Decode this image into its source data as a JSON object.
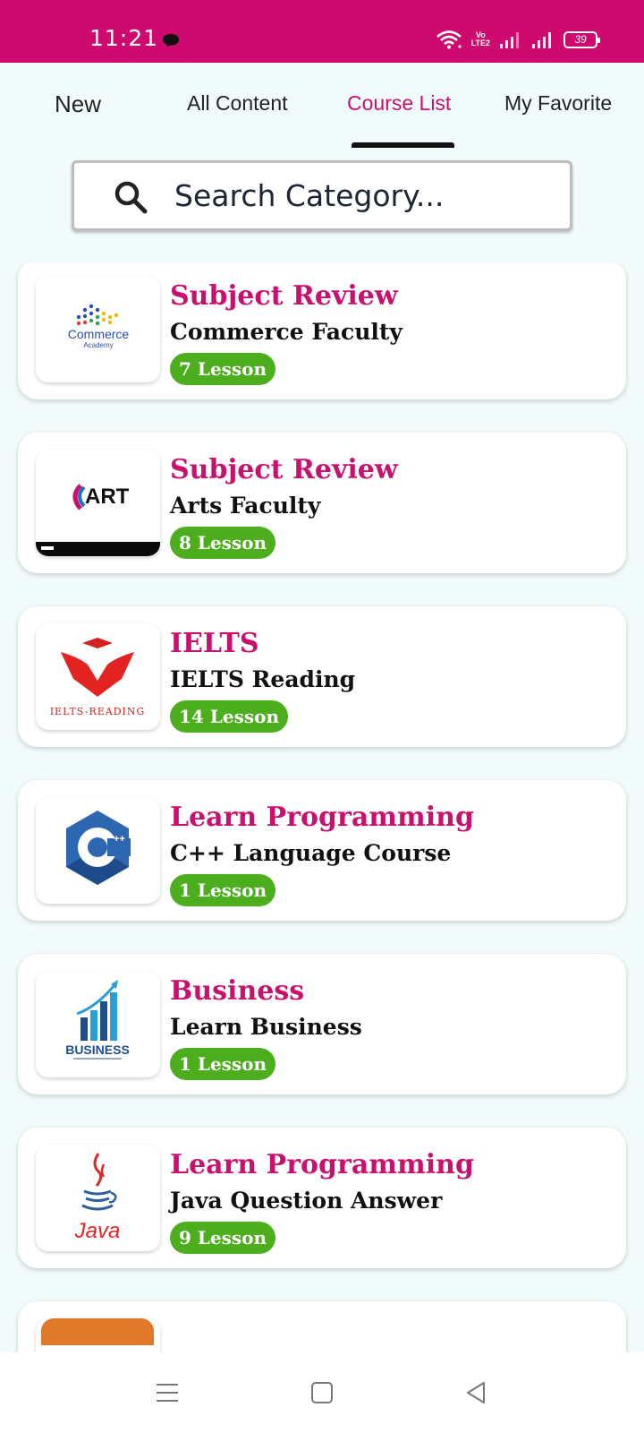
{
  "status_bar": {
    "time": "11:21",
    "battery": "39",
    "network_label": "Vo LTE2",
    "bg_color": "#cf0a6e"
  },
  "tabs": [
    {
      "label": "New",
      "active": false
    },
    {
      "label": "All Content",
      "active": false
    },
    {
      "label": "Course List",
      "active": true
    },
    {
      "label": "My Favorite",
      "active": false
    }
  ],
  "search": {
    "placeholder": "Search Category...",
    "icon": "search-icon"
  },
  "courses": [
    {
      "title": "Subject Review",
      "subtitle": "Commerce Faculty",
      "lessons": "7 Lesson",
      "thumb_icon": "commerce-academy-logo",
      "thumb_text": "Commerce",
      "thumb_subtext": "Academy"
    },
    {
      "title": "Subject Review",
      "subtitle": "Arts Faculty",
      "lessons": "8 Lesson",
      "thumb_icon": "art-logo",
      "thumb_text": "ART"
    },
    {
      "title": "IELTS",
      "subtitle": "IELTS Reading",
      "lessons": "14 Lesson",
      "thumb_icon": "ielts-reading-logo",
      "thumb_text": "IELTS-READING"
    },
    {
      "title": "Learn Programming",
      "subtitle": "C++ Language Course",
      "lessons": "1 Lesson",
      "thumb_icon": "cpp-logo",
      "thumb_text": "C",
      "thumb_subtext": "++"
    },
    {
      "title": "Business",
      "subtitle": "Learn Business",
      "lessons": "1 Lesson",
      "thumb_icon": "business-chart-logo",
      "thumb_text": "BUSINESS"
    },
    {
      "title": "Learn Programming",
      "subtitle": "Java Question Answer",
      "lessons": "9 Lesson",
      "thumb_icon": "java-logo",
      "thumb_text": "Java"
    }
  ],
  "colors": {
    "accent": "#c8116e",
    "badge": "#4cae1c",
    "background": "#f2fbfb"
  },
  "nav_bar": {
    "icons": [
      "menu-icon",
      "home-square-icon",
      "back-triangle-icon"
    ]
  }
}
